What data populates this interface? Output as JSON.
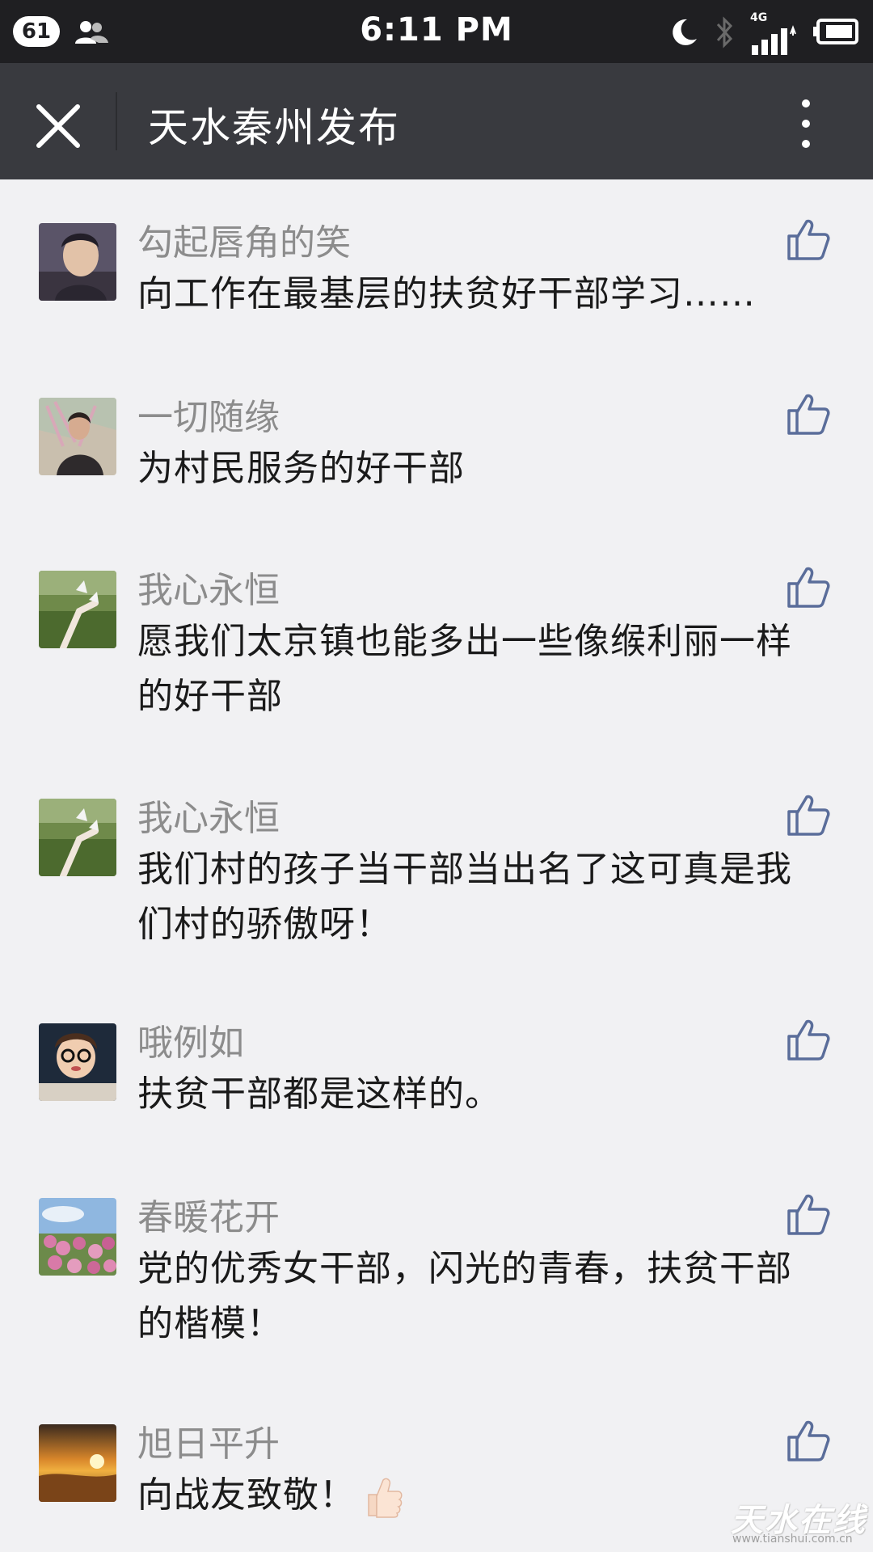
{
  "status_bar": {
    "notification_count": "61",
    "time": "6:11 PM",
    "network": "4G"
  },
  "header": {
    "title": "天水秦州发布"
  },
  "comments": [
    {
      "name": "勾起唇角的笑",
      "text": "向工作在最基层的扶贫好干部学习……"
    },
    {
      "name": "一切随缘",
      "text": "为村民服务的好干部"
    },
    {
      "name": "我心永恒",
      "text": "愿我们太京镇也能多出一些像缑利丽一样的好干部"
    },
    {
      "name": "我心永恒",
      "text": "我们村的孩子当干部当出名了这可真是我们村的骄傲呀！"
    },
    {
      "name": "哦例如",
      "text": "扶贫干部都是这样的。"
    },
    {
      "name": "春暖花开",
      "text": "党的优秀女干部，闪光的青春，扶贫干部的楷模！"
    },
    {
      "name": "旭日平升",
      "text": "向战友致敬！"
    }
  ],
  "watermark": {
    "logo": "天水在线",
    "url": "www.tianshui.com.cn"
  },
  "colors": {
    "status_bar": "#1f1f22",
    "header": "#393a3f",
    "background": "#f1f1f3",
    "like_icon": "#5a6d9a",
    "name_text": "#8c8c8c"
  }
}
